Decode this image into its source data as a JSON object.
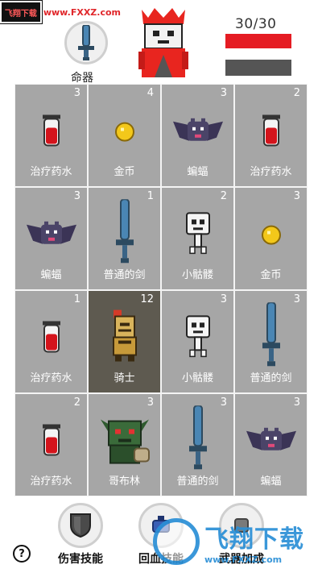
{
  "watermark_top": {
    "logo": "飞翔下载",
    "url": "www.FXXZ.com"
  },
  "hud": {
    "weapon_label": "命器",
    "hp_text": "30/30",
    "hp_fraction": 1.0,
    "xp_fraction": 1.0,
    "colors": {
      "hp": "#e51c23",
      "xp": "#555555"
    }
  },
  "grid": {
    "cells": [
      {
        "count": "3",
        "name": "治疗药水",
        "icon": "potion-icon"
      },
      {
        "count": "4",
        "name": "金币",
        "icon": "coin-icon"
      },
      {
        "count": "3",
        "name": "蝙蝠",
        "icon": "bat-icon"
      },
      {
        "count": "2",
        "name": "治疗药水",
        "icon": "potion-icon"
      },
      {
        "count": "3",
        "name": "蝙蝠",
        "icon": "bat-icon"
      },
      {
        "count": "1",
        "name": "普通的剑",
        "icon": "sword-icon"
      },
      {
        "count": "2",
        "name": "小骷髅",
        "icon": "skeleton-icon"
      },
      {
        "count": "3",
        "name": "金币",
        "icon": "coin-icon"
      },
      {
        "count": "1",
        "name": "治疗药水",
        "icon": "potion-icon"
      },
      {
        "count": "12",
        "name": "骑士",
        "icon": "knight-icon"
      },
      {
        "count": "3",
        "name": "小骷髅",
        "icon": "skeleton-icon"
      },
      {
        "count": "3",
        "name": "普通的剑",
        "icon": "sword-icon"
      },
      {
        "count": "2",
        "name": "治疗药水",
        "icon": "potion-icon"
      },
      {
        "count": "3",
        "name": "哥布林",
        "icon": "goblin-icon"
      },
      {
        "count": "3",
        "name": "普通的剑",
        "icon": "sword-icon"
      },
      {
        "count": "3",
        "name": "蝙蝠",
        "icon": "bat-icon"
      }
    ]
  },
  "skills": [
    {
      "label": "伤害技能",
      "icon": "shield-icon"
    },
    {
      "label": "回血技能",
      "icon": "heal-icon"
    },
    {
      "label": "武器加成",
      "icon": "weapon-boost-icon"
    }
  ],
  "help_label": "?",
  "watermark_bottom": {
    "text": "飞翔下载",
    "url": "www.FXXZ.com"
  }
}
